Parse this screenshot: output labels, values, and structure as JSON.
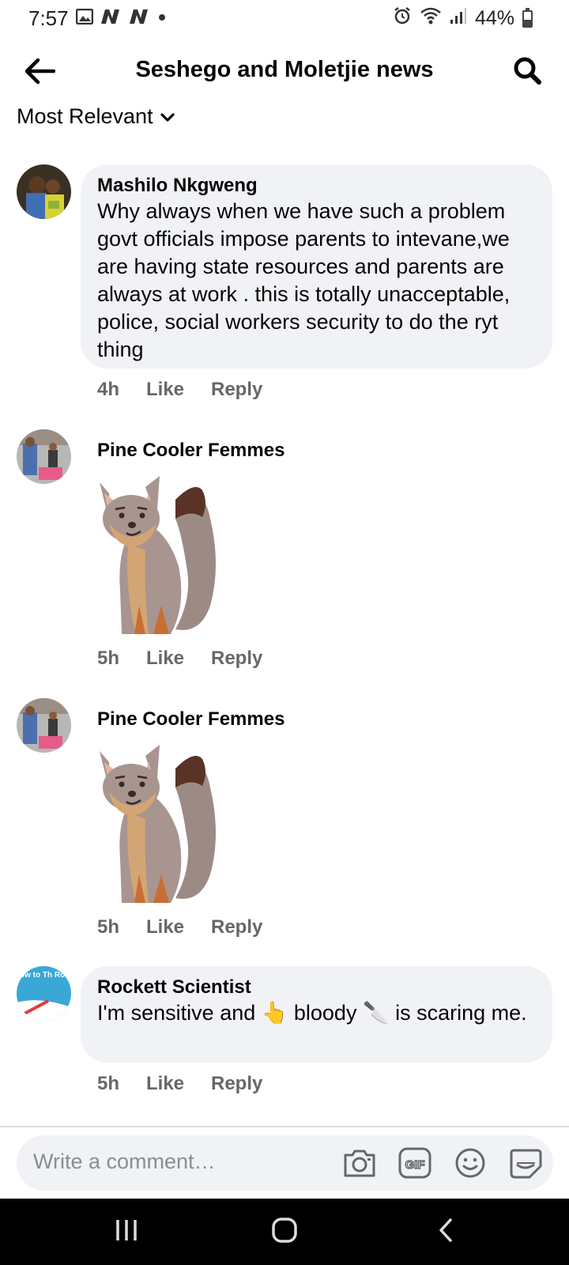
{
  "status_bar": {
    "time": "7:57",
    "battery": "44%",
    "battery_level": 0.44,
    "icons": [
      "gallery-icon",
      "n-app-icon",
      "n-app-icon",
      "dot-icon",
      "alarm-icon",
      "wifi-icon",
      "signal-icon",
      "battery-icon"
    ]
  },
  "header": {
    "title": "Seshego and Moletjie news",
    "back_icon": "arrow-left-icon",
    "search_icon": "search-icon"
  },
  "sort": {
    "label": "Most Relevant",
    "icon": "chevron-down-icon"
  },
  "comments": [
    {
      "author": "Mashilo Nkgweng",
      "text": "Why always when we have such a problem govt officials impose parents to intevane,we are having state resources and parents are always at work . this is totally unacceptable, police, social workers security to do the ryt thing",
      "time": "4h",
      "like": "Like",
      "reply": "Reply"
    },
    {
      "author": "Pine Cooler Femmes",
      "sticker": "fox-sticker",
      "time": "5h",
      "like": "Like",
      "reply": "Reply"
    },
    {
      "author": "Pine Cooler Femmes",
      "sticker": "fox-sticker",
      "time": "5h",
      "like": "Like",
      "reply": "Reply"
    },
    {
      "author": "Rockett Scientist",
      "text_part1": "I'm sensitive and ",
      "emoji1": "👆",
      "text_part2": " bloody ",
      "emoji2": "🔪",
      "text_part3": " is scaring me.",
      "avatar_text": "ow to Th Rocket S",
      "time": "5h",
      "like": "Like",
      "reply": "Reply"
    }
  ],
  "composer": {
    "placeholder": "Write a comment…",
    "icons": [
      "camera-icon",
      "gif-icon",
      "emoji-icon",
      "sticker-icon"
    ]
  },
  "colors": {
    "bubble": "#f0f2f5",
    "secondary_text": "#65676b",
    "primary_text": "#050505"
  }
}
